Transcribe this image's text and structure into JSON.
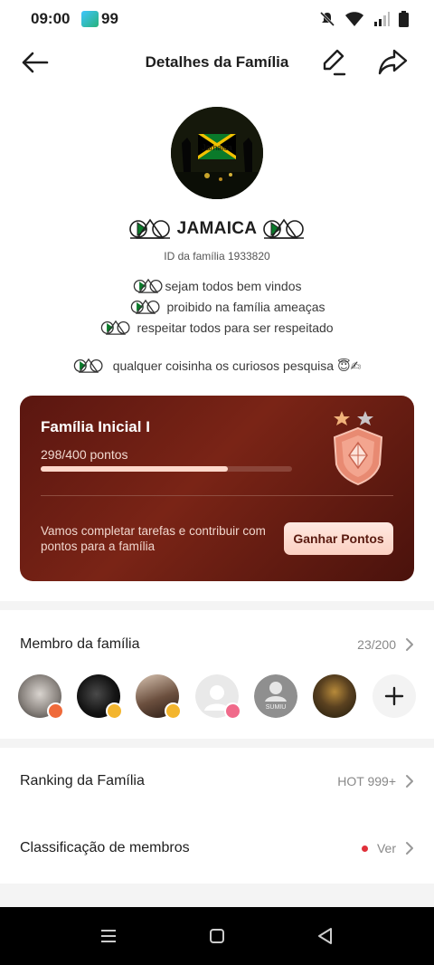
{
  "status": {
    "time": "09:00",
    "notif_count": "99"
  },
  "header": {
    "title": "Detalhes da Família"
  },
  "family": {
    "name": "JAMAICA",
    "id_text": "ID da família 1933820",
    "avatar_text": "Jamaica",
    "descriptions": [
      "sejam todos bem vindos",
      "proibido na família ameaças",
      "respeitar todos para ser respeitado",
      "qualquer coisinha os curiosos pesquisa 😇✍"
    ]
  },
  "level_card": {
    "title": "Família Inicial I",
    "points_text": "298/400 pontos",
    "progress": 0.745,
    "description": "Vamos completar tarefas e contribuir com pontos para a família",
    "button_label": "Ganhar Pontos"
  },
  "members": {
    "title": "Membro da família",
    "count": "23/200",
    "avatar_label": "SUMIU"
  },
  "ranking": {
    "title": "Ranking da Família",
    "value": "HOT 999+"
  },
  "classification": {
    "title": "Classificação de membros",
    "action": "Ver"
  },
  "colors": {
    "accent_red": "#e0303a",
    "card_bg": "#6a1e14"
  }
}
